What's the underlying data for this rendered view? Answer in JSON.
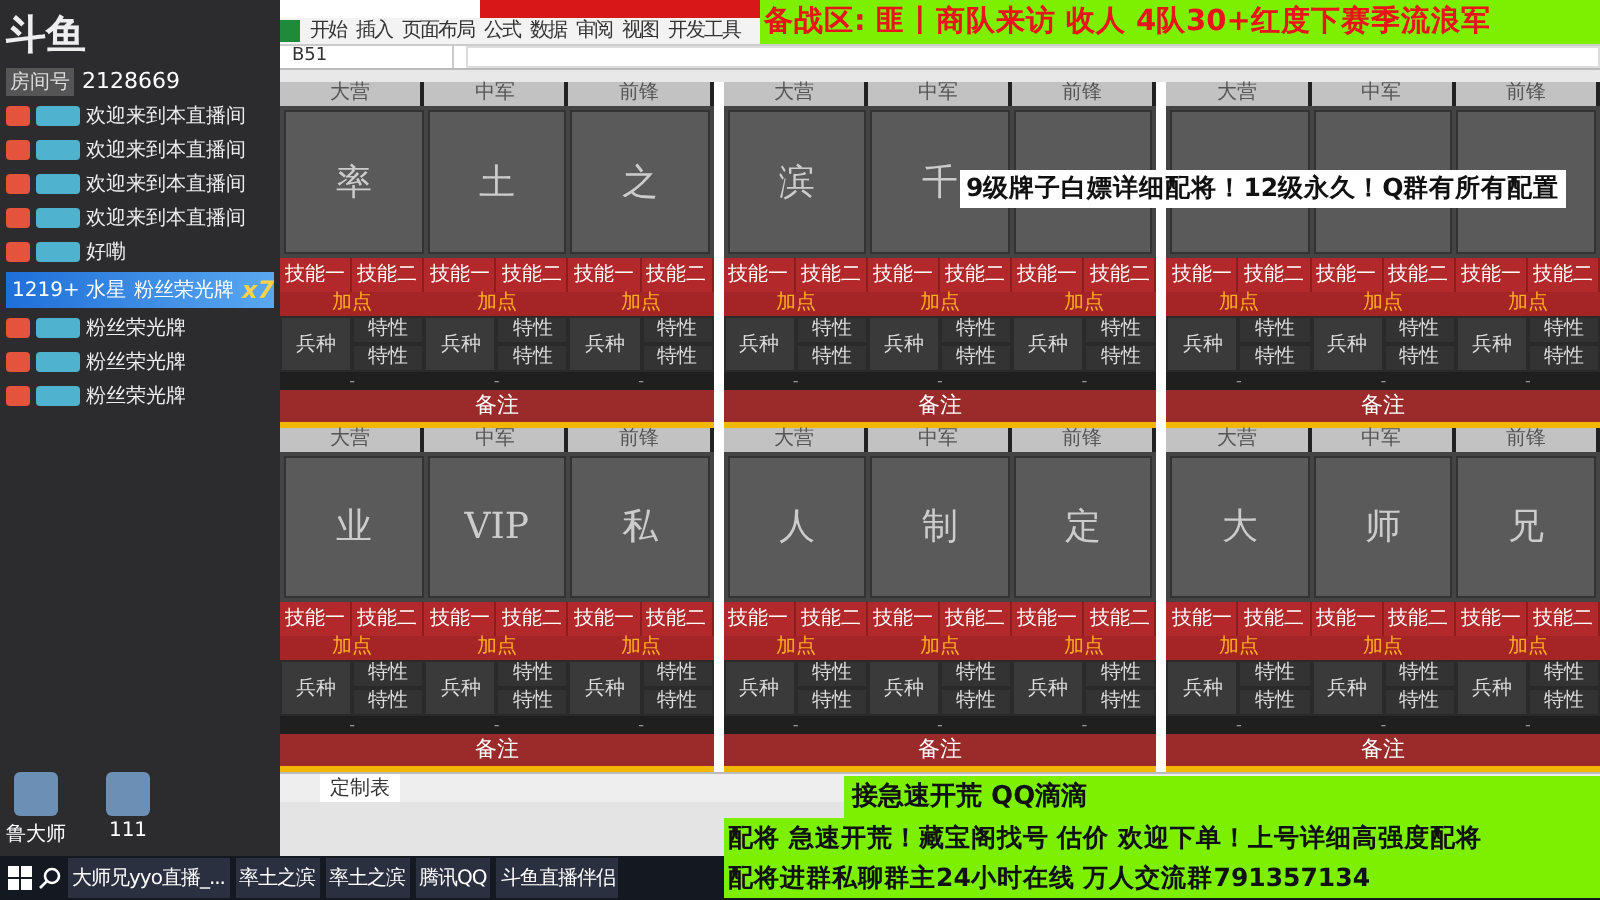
{
  "stream_overlay": {
    "logo": "斗鱼",
    "room_label": "房间号",
    "room_number": "2128669"
  },
  "chat": [
    {
      "kind": "message",
      "text": "欢迎来到本直播间"
    },
    {
      "kind": "message",
      "text": "欢迎来到本直播间"
    },
    {
      "kind": "message",
      "text": "欢迎来到本直播间"
    },
    {
      "kind": "message",
      "text": "欢迎来到本直播间"
    },
    {
      "kind": "message",
      "text": "好嘞"
    },
    {
      "kind": "gift",
      "user": "1219+ 水星",
      "text": "粉丝荣光牌",
      "count": "x7"
    },
    {
      "kind": "message",
      "text": "粉丝荣光牌"
    },
    {
      "kind": "message",
      "text": "粉丝荣光牌"
    },
    {
      "kind": "message",
      "text": "粉丝荣光牌"
    }
  ],
  "desktop_icons": [
    {
      "label": "鲁大师"
    },
    {
      "label": "111"
    }
  ],
  "spreadsheet": {
    "tabs": [
      "开始",
      "插入",
      "页面布局",
      "公式",
      "数据",
      "审阅",
      "视图",
      "开发工具"
    ],
    "name_box": "B51",
    "sheet_tab": "定制表",
    "lineups": [
      {
        "slots": [
          {
            "position": "大营",
            "portrait": "率",
            "skills": [
              "技能一",
              "技能二"
            ],
            "points": "加点",
            "troop": "兵种",
            "traits": [
              "特性",
              "特性"
            ],
            "dash": "-"
          },
          {
            "position": "中军",
            "portrait": "土",
            "skills": [
              "技能一",
              "技能二"
            ],
            "points": "加点",
            "troop": "兵种",
            "traits": [
              "特性",
              "特性"
            ],
            "dash": "-"
          },
          {
            "position": "前锋",
            "portrait": "之",
            "skills": [
              "技能一",
              "技能二"
            ],
            "points": "加点",
            "troop": "兵种",
            "traits": [
              "特性",
              "特性"
            ],
            "dash": "-"
          }
        ],
        "note": "备注"
      },
      {
        "slots": [
          {
            "position": "大营",
            "portrait": "滨",
            "skills": [
              "技能一",
              "技能二"
            ],
            "points": "加点",
            "troop": "兵种",
            "traits": [
              "特性",
              "特性"
            ],
            "dash": "-"
          },
          {
            "position": "中军",
            "portrait": "千",
            "skills": [
              "技能一",
              "技能二"
            ],
            "points": "加点",
            "troop": "兵种",
            "traits": [
              "特性",
              "特性"
            ],
            "dash": "-"
          },
          {
            "position": "前锋",
            "skills": [
              "技能一",
              "技能二"
            ],
            "points": "加点",
            "troop": "兵种",
            "traits": [
              "特性",
              "特性"
            ],
            "dash": "-"
          }
        ],
        "note": "备注"
      },
      {
        "slots": [
          {
            "position": "大营",
            "skills": [
              "技能一",
              "技能二"
            ],
            "points": "加点",
            "troop": "兵种",
            "traits": [
              "特性",
              "特性"
            ],
            "dash": "-"
          },
          {
            "position": "中军",
            "skills": [
              "技能一",
              "技能二"
            ],
            "points": "加点",
            "troop": "兵种",
            "traits": [
              "特性",
              "特性"
            ],
            "dash": "-"
          },
          {
            "position": "前锋",
            "skills": [
              "技能一",
              "技能二"
            ],
            "points": "加点",
            "troop": "兵种",
            "traits": [
              "特性",
              "特性"
            ],
            "dash": "-"
          }
        ],
        "note": "备注"
      },
      {
        "slots": [
          {
            "position": "大营",
            "portrait": "业",
            "skills": [
              "技能一",
              "技能二"
            ],
            "points": "加点",
            "troop": "兵种",
            "traits": [
              "特性",
              "特性"
            ],
            "dash": "-"
          },
          {
            "position": "中军",
            "portrait": "VIP",
            "skills": [
              "技能一",
              "技能二"
            ],
            "points": "加点",
            "troop": "兵种",
            "traits": [
              "特性",
              "特性"
            ],
            "dash": "-"
          },
          {
            "position": "前锋",
            "portrait": "私",
            "skills": [
              "技能一",
              "技能二"
            ],
            "points": "加点",
            "troop": "兵种",
            "traits": [
              "特性",
              "特性"
            ],
            "dash": "-"
          }
        ],
        "note": "备注"
      },
      {
        "slots": [
          {
            "position": "大营",
            "portrait": "人",
            "skills": [
              "技能一",
              "技能二"
            ],
            "points": "加点",
            "troop": "兵种",
            "traits": [
              "特性",
              "特性"
            ],
            "dash": "-"
          },
          {
            "position": "中军",
            "portrait": "制",
            "skills": [
              "技能一",
              "技能二"
            ],
            "points": "加点",
            "troop": "兵种",
            "traits": [
              "特性",
              "特性"
            ],
            "dash": "-"
          },
          {
            "position": "前锋",
            "portrait": "定",
            "skills": [
              "技能一",
              "技能二"
            ],
            "points": "加点",
            "troop": "兵种",
            "traits": [
              "特性",
              "特性"
            ],
            "dash": "-"
          }
        ],
        "note": "备注"
      },
      {
        "slots": [
          {
            "position": "大营",
            "portrait": "大",
            "skills": [
              "技能一",
              "技能二"
            ],
            "points": "加点",
            "troop": "兵种",
            "traits": [
              "特性",
              "特性"
            ],
            "dash": "-"
          },
          {
            "position": "中军",
            "portrait": "师",
            "skills": [
              "技能一",
              "技能二"
            ],
            "points": "加点",
            "troop": "兵种",
            "traits": [
              "特性",
              "特性"
            ],
            "dash": "-"
          },
          {
            "position": "前锋",
            "portrait": "兄",
            "skills": [
              "技能一",
              "技能二"
            ],
            "points": "加点",
            "troop": "兵种",
            "traits": [
              "特性",
              "特性"
            ],
            "dash": "-"
          }
        ],
        "note": "备注"
      }
    ]
  },
  "top_banner": "备战区: 匪丨商队来访 收人 4队30+红度下赛季流浪军",
  "middle_banner": "9级牌子白嫖详细配将！12级永久！Q群有所有配置",
  "bottom_banner": [
    "接急速开荒 QQ滴滴",
    "配将 急速开荒！藏宝阁找号 估价  欢迎下单！上号详细高强度配将",
    "配将进群私聊群主24小时在线 万人交流群791357134"
  ],
  "taskbar": [
    {
      "label": "大师兄yyo直播_..."
    },
    {
      "label": "率土之滨"
    },
    {
      "label": "率土之滨"
    },
    {
      "label": "腾讯QQ"
    },
    {
      "label": "斗鱼直播伴侣"
    }
  ]
}
